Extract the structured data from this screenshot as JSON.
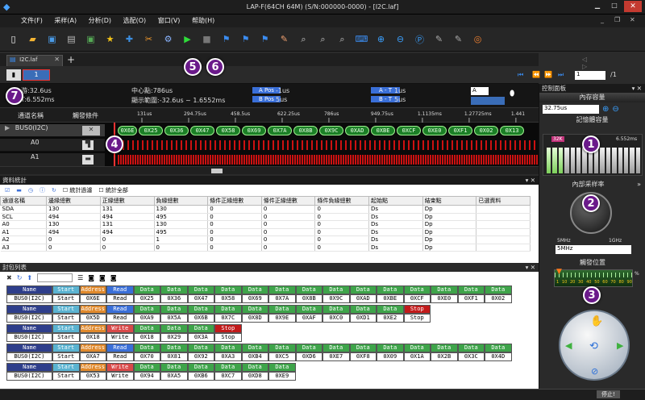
{
  "window": {
    "title": "LAP-F(64CH 64M) (S/N:000000-0000) - [I2C.laf]"
  },
  "menu": [
    "文件(F)",
    "采样(A)",
    "分析(D)",
    "选配(O)",
    "窗口(V)",
    "帮助(H)"
  ],
  "tabs": {
    "file_tab": "I2C.laf",
    "page_input": "1",
    "page_total": "/1"
  },
  "info": {
    "cursor_a_label": "游:32.6us",
    "cursor_b_label": "T:6.552ms",
    "center": "中心點:786us",
    "range": "顯示範圍:-32.6us ~ 1.6552ms",
    "apos_label": "A Pos",
    "apos_val": "-1us",
    "bpos_label": "B Pos",
    "bpos_val": "5us",
    "at_label": "A - T",
    "at_val": "1us",
    "bt_label": "B - T",
    "bt_val": "5us",
    "a_select": "A"
  },
  "ruler": {
    "ticks": [
      "131us",
      "294.75us",
      "458.5us",
      "622.25us",
      "786us",
      "949.75us",
      "1.1135ms",
      "1.27725ms",
      "1.441"
    ]
  },
  "channels": {
    "header_name": "通道名稱",
    "header_trigger": "觸發條件",
    "items": [
      "BUS0(I2C)",
      "A0",
      "A1"
    ]
  },
  "bus_bubbles": [
    "0X6E",
    "0X25",
    "0X36",
    "0X47",
    "0X58",
    "0X69",
    "0X7A",
    "0X8B",
    "0X9C",
    "0XAD",
    "0XBE",
    "0XCF",
    "0XE0",
    "0XF1",
    "0X02",
    "0X13"
  ],
  "stats": {
    "title": "資料統計",
    "chk_filter": "統計過濾",
    "chk_all": "統計全部",
    "headers": [
      "通道名稱",
      "邊緣總數",
      "正緣總數",
      "負緣總數",
      "條件正緣總數",
      "條件正緣總數",
      "條件負緣總數",
      "起始點",
      "結束點",
      "已選資料"
    ],
    "rows": [
      [
        "SDA",
        "130",
        "131",
        "130",
        "0",
        "0",
        "0",
        "Ds",
        "Dp",
        ""
      ],
      [
        "SCL",
        "494",
        "494",
        "495",
        "0",
        "0",
        "0",
        "Ds",
        "Dp",
        ""
      ],
      [
        "A0",
        "130",
        "131",
        "130",
        "0",
        "0",
        "0",
        "Ds",
        "Dp",
        ""
      ],
      [
        "A1",
        "494",
        "494",
        "495",
        "0",
        "0",
        "0",
        "Ds",
        "Dp",
        ""
      ],
      [
        "A2",
        "0",
        "0",
        "1",
        "0",
        "0",
        "0",
        "Ds",
        "Dp",
        ""
      ],
      [
        "A3",
        "0",
        "0",
        "0",
        "0",
        "0",
        "0",
        "Ds",
        "Dp",
        ""
      ]
    ]
  },
  "packets": {
    "title": "封包列表",
    "rows": [
      {
        "type": "Read",
        "addr": "0X6E",
        "data": [
          "0X25",
          "0X36",
          "0X47",
          "0X58",
          "0X69",
          "0X7A",
          "0X8B",
          "0X9C",
          "0XAD",
          "0XBE",
          "0XCF",
          "0XE0",
          "0XF1",
          "0X02"
        ],
        "stop": false
      },
      {
        "type": "Read",
        "addr": "0X5D",
        "data": [
          "0XA9",
          "0X5A",
          "0X6B",
          "0X7C",
          "0X8D",
          "0X9E",
          "0XAF",
          "0XC0",
          "0XD1",
          "0XE2"
        ],
        "stop": true
      },
      {
        "type": "Write",
        "addr": "0X18",
        "data": [
          "0X18",
          "0X29",
          "0X3A"
        ],
        "stop": true
      },
      {
        "type": "Read",
        "addr": "0XA7",
        "data": [
          "0X70",
          "0X81",
          "0X92",
          "0XA3",
          "0XB4",
          "0XC5",
          "0XD6",
          "0XE7",
          "0XF8",
          "0X09",
          "0X1A",
          "0X2B",
          "0X3C",
          "0X4D"
        ],
        "stop": false
      },
      {
        "type": "Write",
        "addr": "0X53",
        "data": [
          "0X94",
          "0XA5",
          "0XB6",
          "0XC7",
          "0XD8",
          "0XE9"
        ],
        "stop": false
      }
    ],
    "labels": {
      "name": "Name",
      "bus": "BUS0(I2C)",
      "start": "Start",
      "address": "Address",
      "data": "Data",
      "stop": "Stop"
    }
  },
  "right_panel": {
    "title": "控制面板",
    "mem_hdr": "內存容量",
    "mem_val": "32.75us",
    "trig_hdr": "記憶體容量",
    "trig_marker": "32K",
    "trig_time": "6.552ms",
    "rate_hdr": "內部采样率",
    "rate_min": "5MHz",
    "rate_max": "1GHz",
    "rate_sel": "5MHz",
    "pos_hdr": "觸發位置",
    "pos_scale": [
      "1",
      "10",
      "20",
      "30",
      "40",
      "50",
      "60",
      "70",
      "80",
      "90"
    ],
    "pos_pct": "%"
  },
  "statusbar": {
    "stop": "停止!"
  },
  "badges": [
    "1",
    "2",
    "3",
    "4",
    "5",
    "6",
    "7"
  ]
}
